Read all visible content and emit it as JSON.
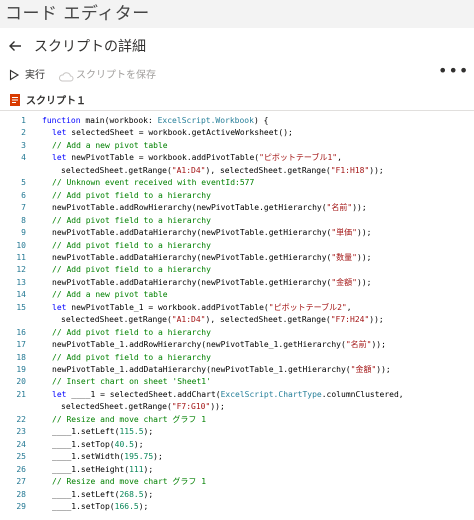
{
  "app": {
    "title": "コード エディター"
  },
  "header": {
    "title": "スクリプトの詳細",
    "back_icon": "back-arrow-icon"
  },
  "toolbar": {
    "run_label": "実行",
    "run_icon": "play-icon",
    "save_label": "スクリプトを保存",
    "save_icon": "cloud-save-icon",
    "save_enabled": false,
    "more_label": "•••",
    "more_icon": "more-icon"
  },
  "file": {
    "name": "スクリプト１",
    "icon": "script-file-icon",
    "icon_color": "#d83b01"
  },
  "colors": {
    "keyword": "#0000ff",
    "type": "#267f99",
    "string": "#a31515",
    "comment": "#008000",
    "number": "#098658",
    "line_number": "#237893"
  },
  "editor": {
    "lines": [
      {
        "num": "1",
        "indent": 0,
        "tokens": [
          [
            "k",
            "function "
          ],
          [
            "p",
            "main(workbook: "
          ],
          [
            "t",
            "ExcelScript.Workbook"
          ],
          [
            "p",
            ") {"
          ]
        ]
      },
      {
        "num": "2",
        "indent": 1,
        "tokens": [
          [
            "k",
            "let "
          ],
          [
            "p",
            "selectedSheet = workbook.getActiveWorksheet();"
          ]
        ]
      },
      {
        "num": "3",
        "indent": 1,
        "tokens": [
          [
            "c",
            "// Add a new pivot table"
          ]
        ]
      },
      {
        "num": "4",
        "indent": 1,
        "tokens": [
          [
            "k",
            "let "
          ],
          [
            "p",
            "newPivotTable = workbook.addPivotTable("
          ],
          [
            "s",
            "\"ピボットテーブル1\""
          ],
          [
            "p",
            ","
          ]
        ]
      },
      {
        "num": "",
        "indent": 2,
        "tokens": [
          [
            "p",
            "selectedSheet.getRange("
          ],
          [
            "s",
            "\"A1:D4\""
          ],
          [
            "p",
            "), selectedSheet.getRange("
          ],
          [
            "s",
            "\"F1:H18\""
          ],
          [
            "p",
            "));"
          ]
        ]
      },
      {
        "num": "5",
        "indent": 1,
        "tokens": [
          [
            "c",
            "// Unknown event received with eventId:577"
          ]
        ]
      },
      {
        "num": "6",
        "indent": 1,
        "tokens": [
          [
            "c",
            "// Add pivot field to a hierarchy"
          ]
        ]
      },
      {
        "num": "7",
        "indent": 1,
        "tokens": [
          [
            "p",
            "newPivotTable.addRowHierarchy(newPivotTable.getHierarchy("
          ],
          [
            "s",
            "\"名前\""
          ],
          [
            "p",
            "));"
          ]
        ]
      },
      {
        "num": "8",
        "indent": 1,
        "tokens": [
          [
            "c",
            "// Add pivot field to a hierarchy"
          ]
        ]
      },
      {
        "num": "9",
        "indent": 1,
        "tokens": [
          [
            "p",
            "newPivotTable.addDataHierarchy(newPivotTable.getHierarchy("
          ],
          [
            "s",
            "\"単価\""
          ],
          [
            "p",
            "));"
          ]
        ]
      },
      {
        "num": "10",
        "indent": 1,
        "tokens": [
          [
            "c",
            "// Add pivot field to a hierarchy"
          ]
        ]
      },
      {
        "num": "11",
        "indent": 1,
        "tokens": [
          [
            "p",
            "newPivotTable.addDataHierarchy(newPivotTable.getHierarchy("
          ],
          [
            "s",
            "\"数量\""
          ],
          [
            "p",
            "));"
          ]
        ]
      },
      {
        "num": "12",
        "indent": 1,
        "tokens": [
          [
            "c",
            "// Add pivot field to a hierarchy"
          ]
        ]
      },
      {
        "num": "13",
        "indent": 1,
        "tokens": [
          [
            "p",
            "newPivotTable.addDataHierarchy(newPivotTable.getHierarchy("
          ],
          [
            "s",
            "\"金額\""
          ],
          [
            "p",
            "));"
          ]
        ]
      },
      {
        "num": "14",
        "indent": 1,
        "tokens": [
          [
            "c",
            "// Add a new pivot table"
          ]
        ]
      },
      {
        "num": "15",
        "indent": 1,
        "tokens": [
          [
            "k",
            "let "
          ],
          [
            "p",
            "newPivotTable_1 = workbook.addPivotTable("
          ],
          [
            "s",
            "\"ピボットテーブル2\""
          ],
          [
            "p",
            ","
          ]
        ]
      },
      {
        "num": "",
        "indent": 2,
        "tokens": [
          [
            "p",
            "selectedSheet.getRange("
          ],
          [
            "s",
            "\"A1:D4\""
          ],
          [
            "p",
            "), selectedSheet.getRange("
          ],
          [
            "s",
            "\"F7:H24\""
          ],
          [
            "p",
            "));"
          ]
        ]
      },
      {
        "num": "16",
        "indent": 1,
        "tokens": [
          [
            "c",
            "// Add pivot field to a hierarchy"
          ]
        ]
      },
      {
        "num": "17",
        "indent": 1,
        "tokens": [
          [
            "p",
            "newPivotTable_1.addRowHierarchy(newPivotTable_1.getHierarchy("
          ],
          [
            "s",
            "\"名前\""
          ],
          [
            "p",
            "));"
          ]
        ]
      },
      {
        "num": "18",
        "indent": 1,
        "tokens": [
          [
            "c",
            "// Add pivot field to a hierarchy"
          ]
        ]
      },
      {
        "num": "19",
        "indent": 1,
        "tokens": [
          [
            "p",
            "newPivotTable_1.addDataHierarchy(newPivotTable_1.getHierarchy("
          ],
          [
            "s",
            "\"金額\""
          ],
          [
            "p",
            "));"
          ]
        ]
      },
      {
        "num": "20",
        "indent": 1,
        "tokens": [
          [
            "c",
            "// Insert chart on sheet 'Sheet1'"
          ]
        ]
      },
      {
        "num": "21",
        "indent": 1,
        "tokens": [
          [
            "k",
            "let "
          ],
          [
            "p",
            "____1 = selectedSheet.addChart("
          ],
          [
            "t",
            "ExcelScript.ChartType"
          ],
          [
            "p",
            ".columnClustered,"
          ]
        ]
      },
      {
        "num": "",
        "indent": 2,
        "tokens": [
          [
            "p",
            "selectedSheet.getRange("
          ],
          [
            "s",
            "\"F7:G10\""
          ],
          [
            "p",
            "));"
          ]
        ]
      },
      {
        "num": "22",
        "indent": 1,
        "tokens": [
          [
            "c",
            "// Resize and move chart グラフ 1"
          ]
        ]
      },
      {
        "num": "23",
        "indent": 1,
        "tokens": [
          [
            "p",
            "____1.setLeft("
          ],
          [
            "n",
            "115.5"
          ],
          [
            "p",
            ");"
          ]
        ]
      },
      {
        "num": "24",
        "indent": 1,
        "tokens": [
          [
            "p",
            "____1.setTop("
          ],
          [
            "n",
            "40.5"
          ],
          [
            "p",
            ");"
          ]
        ]
      },
      {
        "num": "25",
        "indent": 1,
        "tokens": [
          [
            "p",
            "____1.setWidth("
          ],
          [
            "n",
            "195.75"
          ],
          [
            "p",
            ");"
          ]
        ]
      },
      {
        "num": "26",
        "indent": 1,
        "tokens": [
          [
            "p",
            "____1.setHeight("
          ],
          [
            "n",
            "111"
          ],
          [
            "p",
            ");"
          ]
        ]
      },
      {
        "num": "27",
        "indent": 1,
        "tokens": [
          [
            "c",
            "// Resize and move chart グラフ 1"
          ]
        ]
      },
      {
        "num": "28",
        "indent": 1,
        "tokens": [
          [
            "p",
            "____1.setLeft("
          ],
          [
            "n",
            "268.5"
          ],
          [
            "p",
            ");"
          ]
        ]
      },
      {
        "num": "29",
        "indent": 1,
        "tokens": [
          [
            "p",
            "____1.setTop("
          ],
          [
            "n",
            "166.5"
          ],
          [
            "p",
            ");"
          ]
        ]
      }
    ]
  }
}
